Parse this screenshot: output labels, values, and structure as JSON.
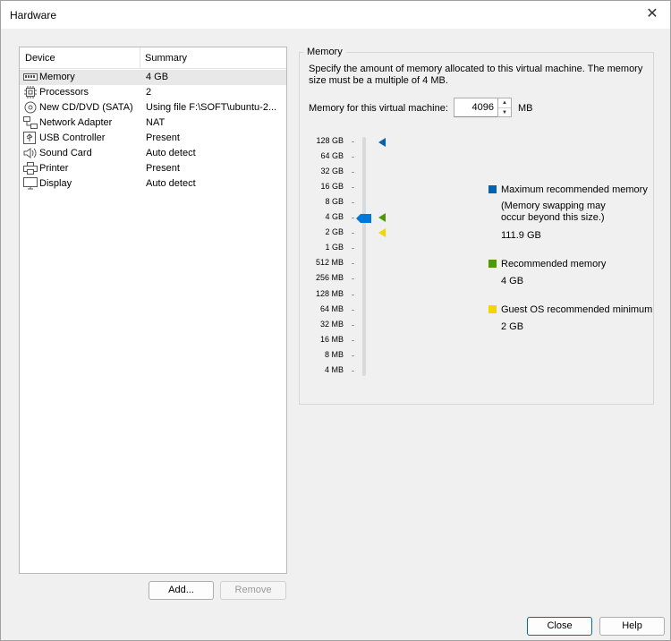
{
  "window": {
    "title": "Hardware"
  },
  "devices": {
    "header": {
      "device": "Device",
      "summary": "Summary"
    },
    "rows": [
      {
        "name": "Memory",
        "summary": "4 GB",
        "icon": "memory-icon"
      },
      {
        "name": "Processors",
        "summary": "2",
        "icon": "processor-icon"
      },
      {
        "name": "New CD/DVD (SATA)",
        "summary": "Using file F:\\SOFT\\ubuntu-2...",
        "icon": "cd-dvd-icon"
      },
      {
        "name": "Network Adapter",
        "summary": "NAT",
        "icon": "network-adapter-icon"
      },
      {
        "name": "USB Controller",
        "summary": "Present",
        "icon": "usb-icon"
      },
      {
        "name": "Sound Card",
        "summary": "Auto detect",
        "icon": "speaker-icon"
      },
      {
        "name": "Printer",
        "summary": "Present",
        "icon": "printer-icon"
      },
      {
        "name": "Display",
        "summary": "Auto detect",
        "icon": "display-icon"
      }
    ],
    "add_label": "Add...",
    "remove_label": "Remove"
  },
  "memory": {
    "group_title": "Memory",
    "description": "Specify the amount of memory allocated to this virtual machine. The memory size must be a multiple of 4 MB.",
    "field_label": "Memory for this virtual machine:",
    "value": "4096",
    "unit": "MB",
    "scale_labels": [
      "128 GB",
      "64 GB",
      "32 GB",
      "16 GB",
      "8 GB",
      "4 GB",
      "2 GB",
      "1 GB",
      "512 MB",
      "256 MB",
      "128 MB",
      "64 MB",
      "32 MB",
      "16 MB",
      "8 MB",
      "4 MB"
    ],
    "legend": {
      "max_title": "Maximum recommended memory",
      "max_note": "(Memory swapping may occur beyond this size.)",
      "max_value": "111.9 GB",
      "rec_title": "Recommended memory",
      "rec_value": "4 GB",
      "min_title": "Guest OS recommended minimum",
      "min_value": "2 GB"
    },
    "colors": {
      "max": "#0063b1",
      "rec": "#4e9a06",
      "min": "#f2d600",
      "slider": "#0078d7"
    }
  },
  "buttons": {
    "close": "Close",
    "help": "Help"
  }
}
